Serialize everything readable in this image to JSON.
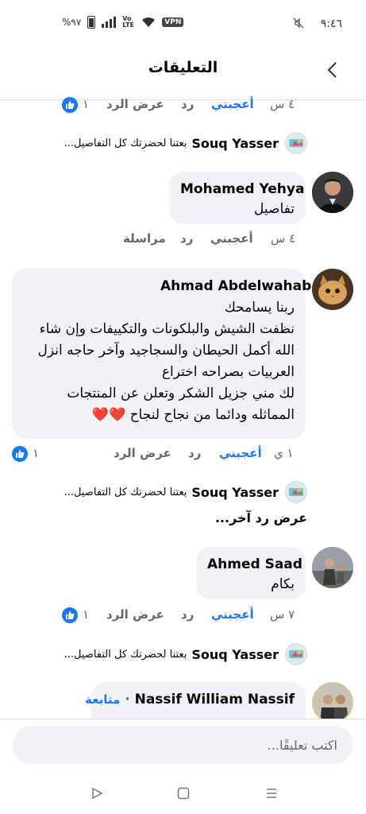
{
  "status_bar": {
    "time": "٩:٤٦",
    "battery": "%٩٧",
    "volte": "Vo LTE",
    "vpn": "VPN"
  },
  "header": {
    "title": "التعليقات"
  },
  "actions": {
    "like": "أعجبني",
    "reply": "رد",
    "show_reply": "عرض الرد",
    "message": "مراسلة"
  },
  "comments": [
    {
      "meta": {
        "time": "٤ س",
        "like_count": "١"
      },
      "author_reply": {
        "name": "Souq Yasser",
        "text": "بعتنا لحضرتك كل التفاصيل..."
      }
    },
    {
      "author": "Mohamed Yehya",
      "text": "تفاصيل",
      "meta": {
        "time": "٤ س"
      }
    },
    {
      "author": "Ahmad Abdelwahab",
      "lines": [
        "ربنا يسامحك",
        "نظفت الشيش والبلكونات والتكييفات وإن شاء",
        "الله أكمل الحيطان والسجاجيد وآخر حاجه انزل",
        "العربيات بصراحه اختراع",
        "لك مني جزيل الشكر وتعلن عن المنتجات",
        "المماثله ودائما من نجاح لنجاح"
      ],
      "hearts": "❤️❤️",
      "meta": {
        "time": "١ ي",
        "like_count": "١"
      },
      "author_reply": {
        "name": "Souq Yasser",
        "text": "بعتنا لحضرتك كل التفاصيل..."
      },
      "more_replies": "عرض رد آخر..."
    },
    {
      "author": "Ahmed Saad",
      "text": "بكام",
      "meta": {
        "time": "٧ س",
        "like_count": "١"
      },
      "author_reply": {
        "name": "Souq Yasser",
        "text": "بعتنا لحضرتك كل التفاصيل..."
      }
    },
    {
      "author": "Nassif William Nassif",
      "follow": "متابعة"
    }
  ],
  "composer": {
    "placeholder": "اكتب تعليقًا..."
  },
  "icons": {
    "back": "chevron-right-icon",
    "like_badge": "thumbs-up-icon",
    "nav": [
      "menu-icon",
      "home-square-icon",
      "back-triangle-icon"
    ]
  },
  "colors": {
    "accent": "#1877f2",
    "bubble": "#f0f2f5",
    "muted": "#65676b"
  }
}
